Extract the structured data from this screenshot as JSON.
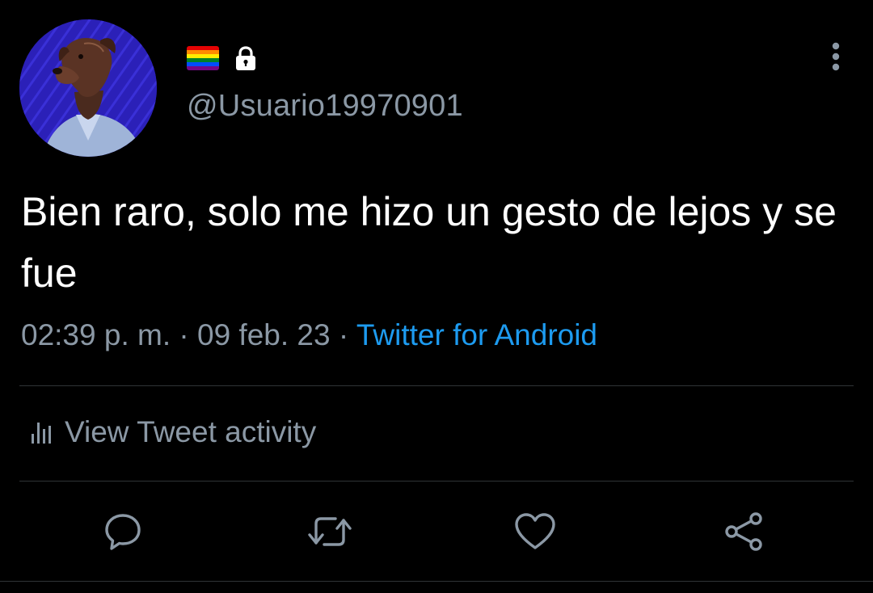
{
  "header": {
    "handle": "@Usuario19970901",
    "avatar_bg": "#2a1fb0",
    "badges": {
      "flag_colors": [
        "#e40303",
        "#ff8c00",
        "#ffed00",
        "#008026",
        "#004dff",
        "#750787"
      ],
      "lock_icon": "lock-icon"
    },
    "more_icon": "more-vertical-icon"
  },
  "tweet": {
    "text": "Bien raro, solo me hizo un gesto de lejos y se fue",
    "time": "02:39 p. m.",
    "separator": "·",
    "date": "09 feb. 23",
    "source": "Twitter for Android"
  },
  "activity": {
    "icon": "bar-chart-icon",
    "label": "View Tweet activity"
  },
  "actions": [
    {
      "name": "reply",
      "icon": "reply-icon"
    },
    {
      "name": "retweet",
      "icon": "retweet-icon"
    },
    {
      "name": "like",
      "icon": "heart-icon"
    },
    {
      "name": "share",
      "icon": "share-icon"
    }
  ],
  "colors": {
    "background": "#000000",
    "text_primary": "#ffffff",
    "text_secondary": "#8b98a5",
    "accent": "#1d9bf0",
    "divider": "#2f3336"
  }
}
